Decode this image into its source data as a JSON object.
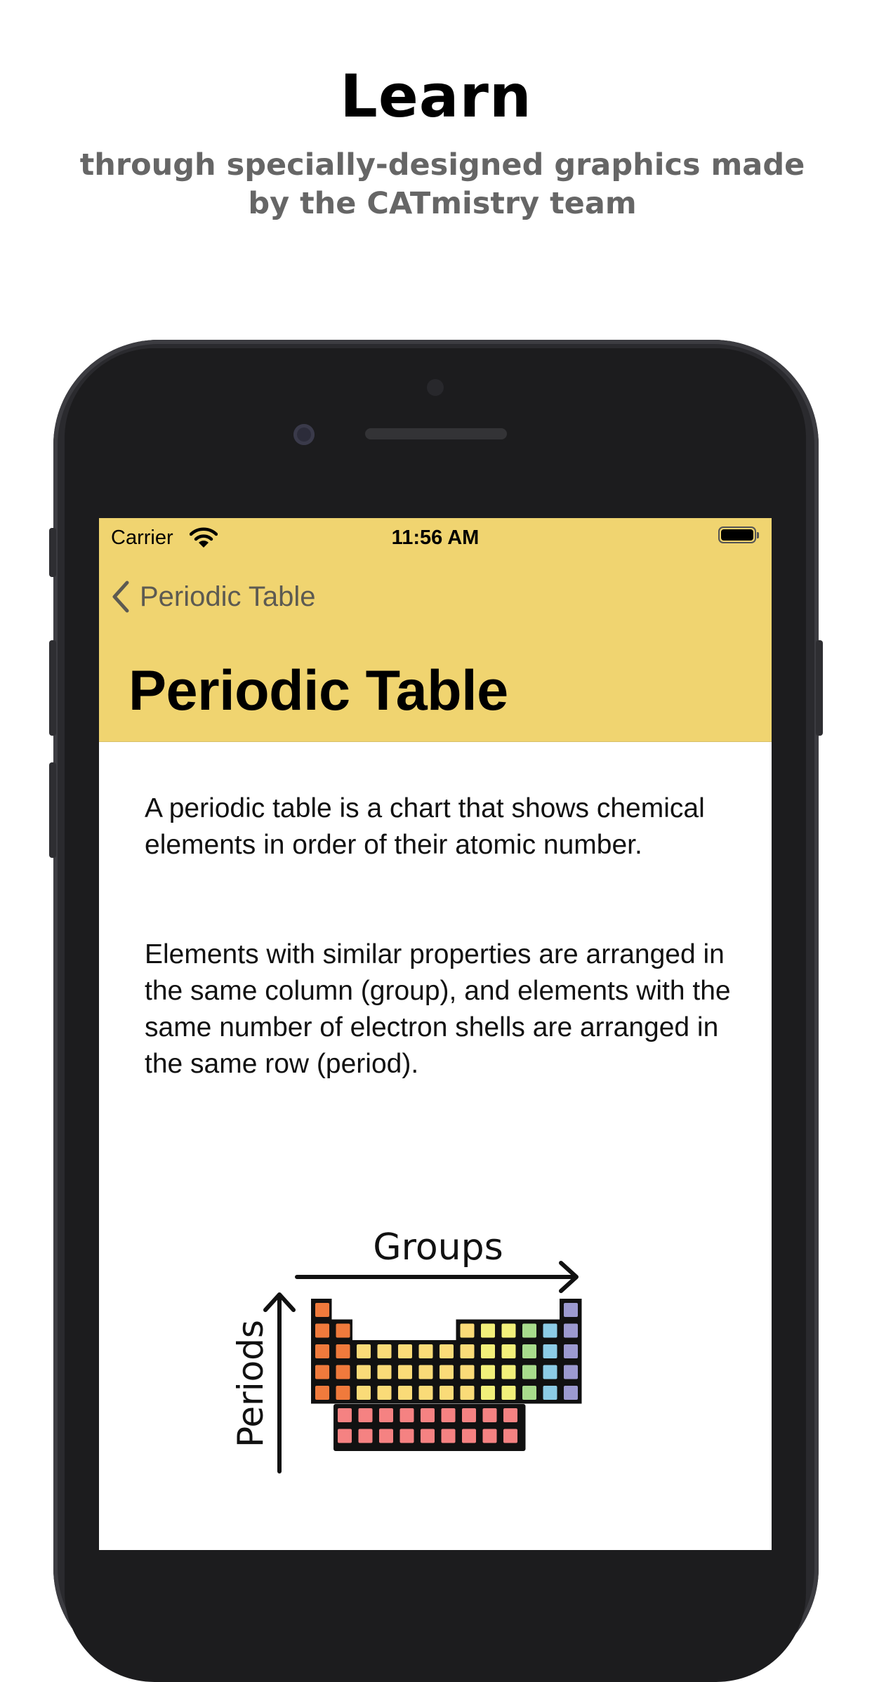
{
  "promo": {
    "title": "Learn",
    "subtitle": "through specially-designed graphics made by the CATmistry team"
  },
  "status_bar": {
    "carrier": "Carrier",
    "time": "11:56 AM"
  },
  "nav": {
    "back_label": "Periodic Table",
    "large_title": "Periodic Table",
    "background_color": "#f0d470"
  },
  "content": {
    "paragraph_1": "A periodic table is a chart that shows chemical elements in order of their atomic number.",
    "paragraph_2": "Elements with similar properties are arranged in the same column (group), and elements with the same number of electron shells are arranged in the same row (period)."
  },
  "diagram": {
    "groups_label": "Groups",
    "periods_label": "Periods",
    "colors": {
      "orange": "#f07a3c",
      "yellow": "#fadb78",
      "lime": "#f2f07a",
      "green": "#a8dc8c",
      "blue": "#8ccce6",
      "purple": "#9c9ad0",
      "pink": "#f58282"
    }
  }
}
